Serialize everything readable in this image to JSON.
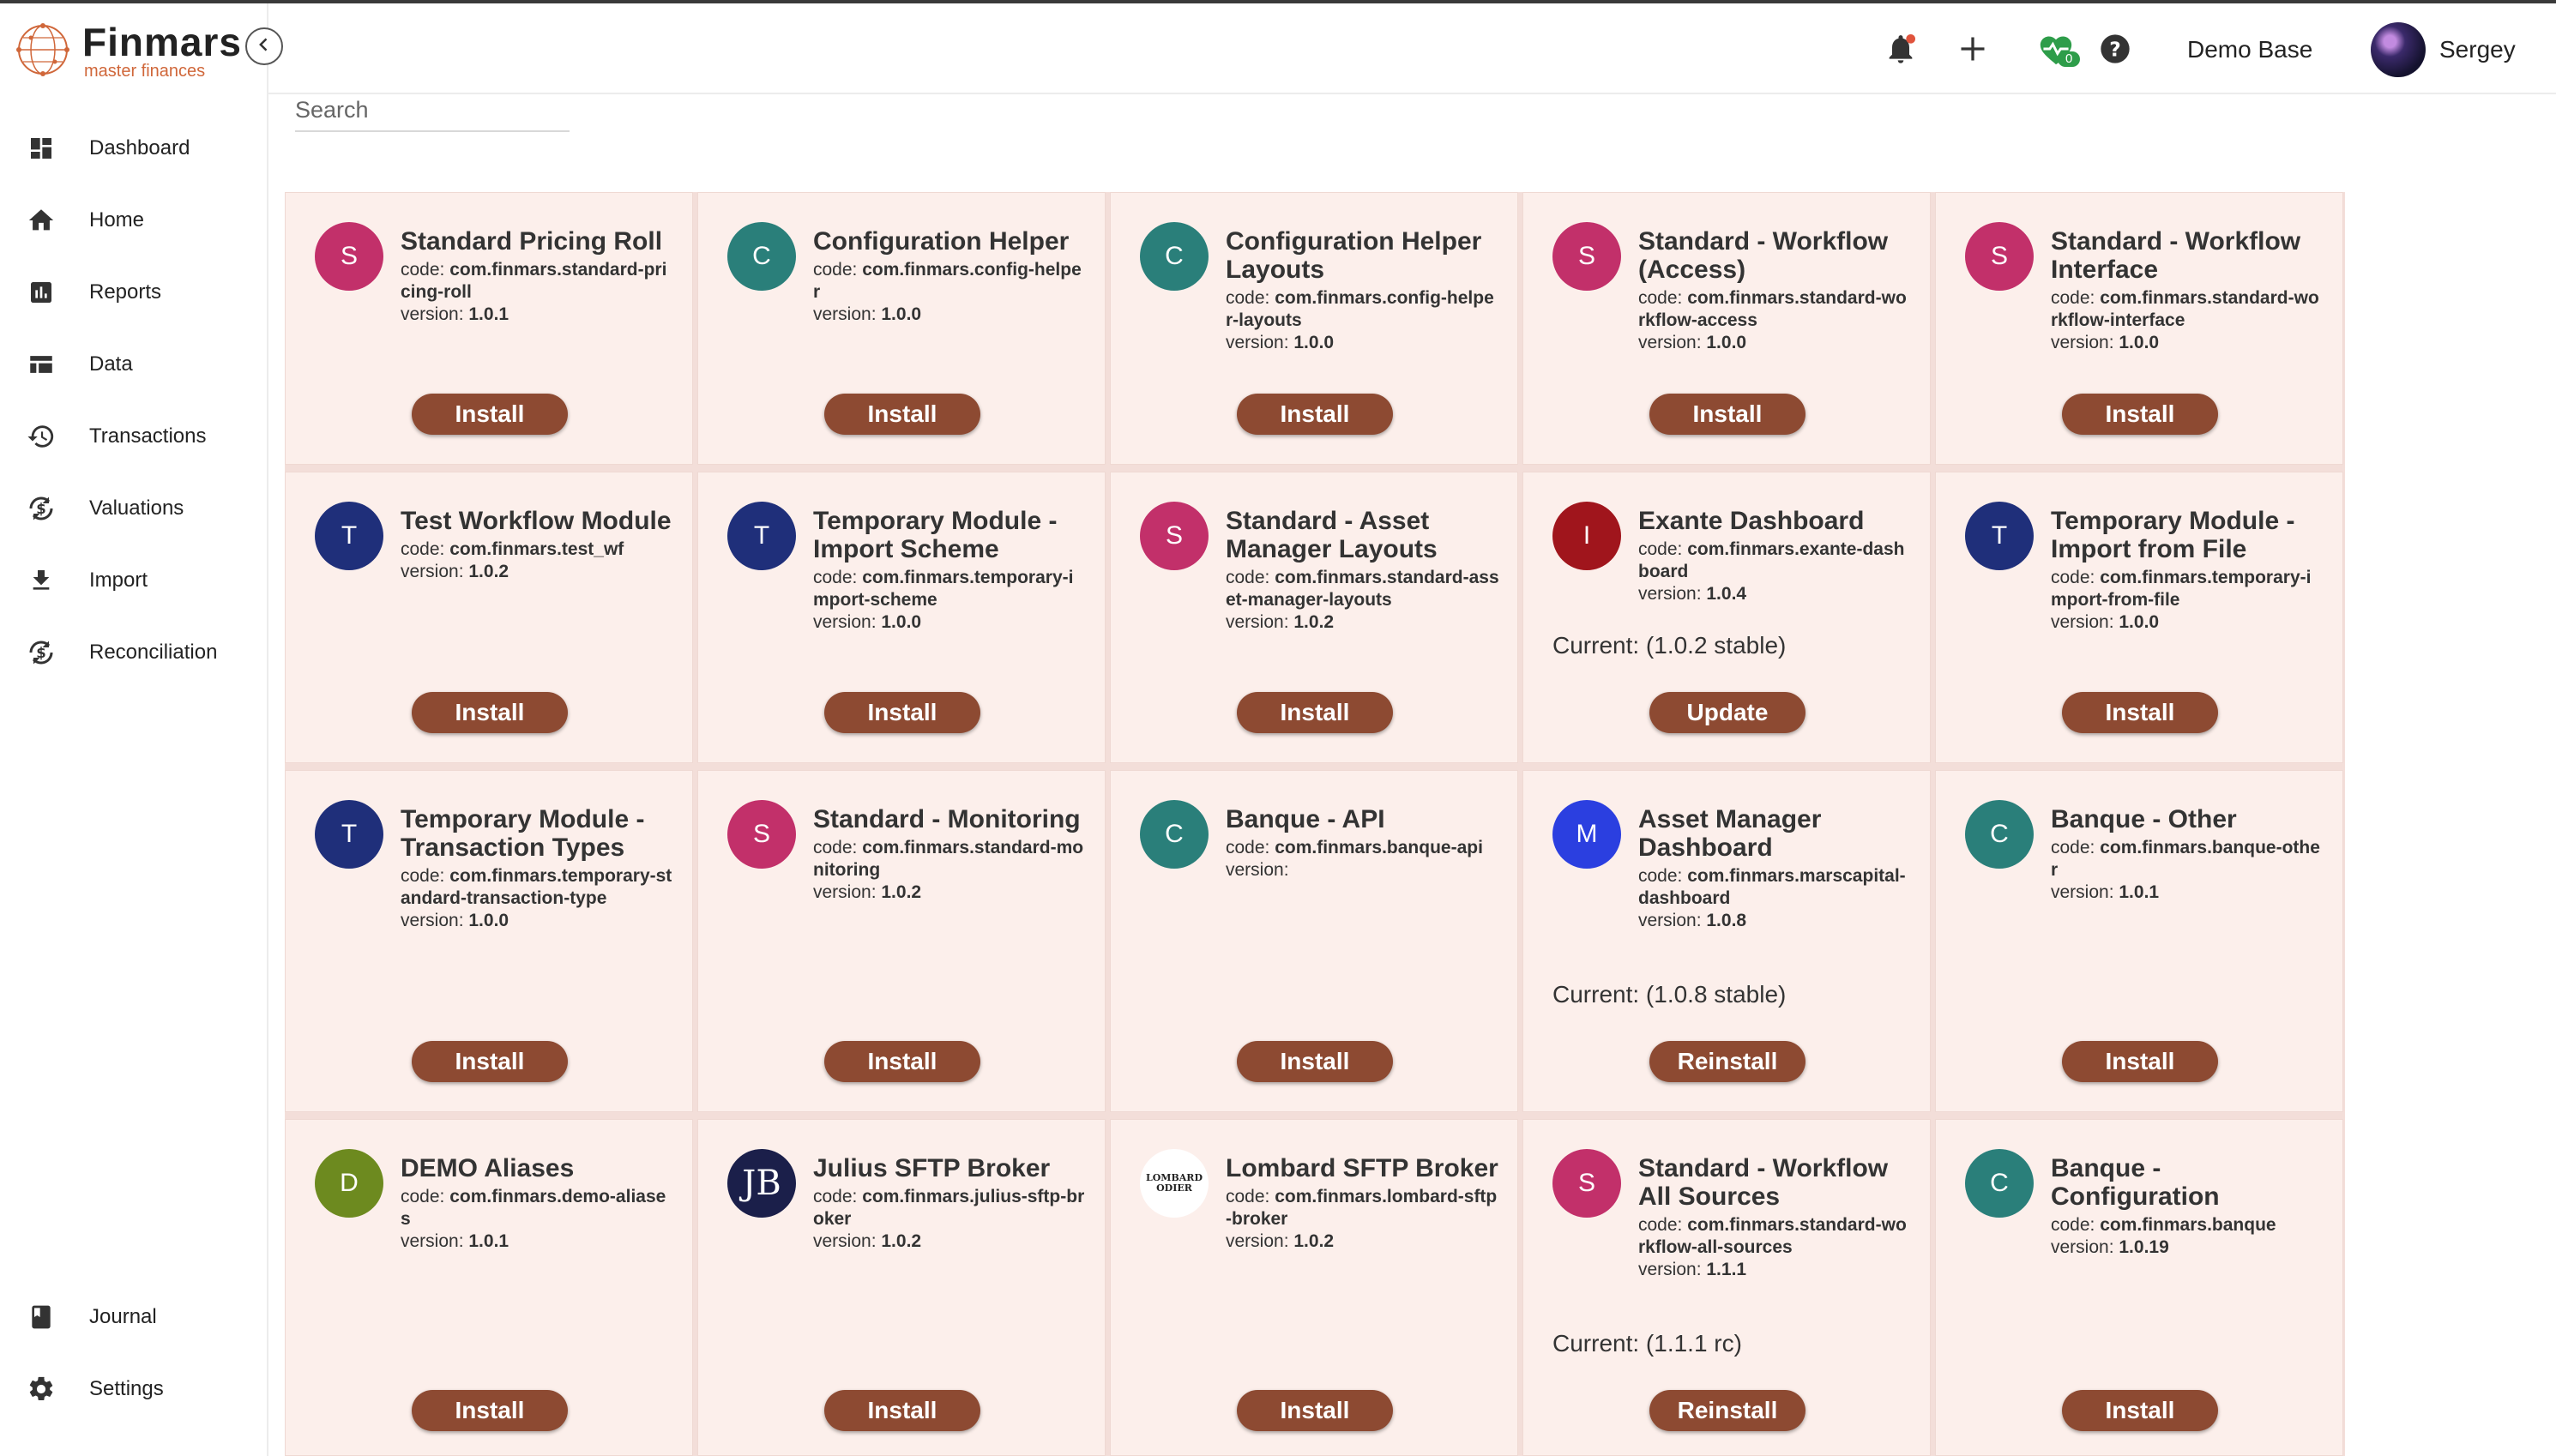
{
  "app": {
    "name": "Finmars",
    "tagline": "master finances"
  },
  "sidebar": {
    "items": [
      {
        "label": "Dashboard",
        "icon": "dashboard-icon"
      },
      {
        "label": "Home",
        "icon": "home-icon"
      },
      {
        "label": "Reports",
        "icon": "reports-icon"
      },
      {
        "label": "Data",
        "icon": "data-icon"
      },
      {
        "label": "Transactions",
        "icon": "history-icon"
      },
      {
        "label": "Valuations",
        "icon": "currency-sync-icon"
      },
      {
        "label": "Import",
        "icon": "download-icon"
      },
      {
        "label": "Reconciliation",
        "icon": "currency-sync-icon"
      }
    ],
    "bottom_items": [
      {
        "label": "Journal",
        "icon": "book-icon"
      },
      {
        "label": "Settings",
        "icon": "gear-icon"
      }
    ]
  },
  "header": {
    "health_count": "0",
    "base_name": "Demo Base",
    "user_name": "Sergey"
  },
  "search": {
    "placeholder": "Search"
  },
  "labels": {
    "code": "code:",
    "version": "version:"
  },
  "modules": [
    {
      "initial": "S",
      "color": "#c2306a",
      "title": "Standard Pricing Roll",
      "code": "com.finmars.standard-pricing-roll",
      "version": "1.0.1",
      "action": "Install"
    },
    {
      "initial": "C",
      "color": "#2a7f7a",
      "title": "Configuration Helper",
      "code": "com.finmars.config-helper",
      "version": "1.0.0",
      "action": "Install"
    },
    {
      "initial": "C",
      "color": "#2a7f7a",
      "title": "Configuration Helper Layouts",
      "code": "com.finmars.config-helper-layouts",
      "version": "1.0.0",
      "action": "Install"
    },
    {
      "initial": "S",
      "color": "#c2306a",
      "title": "Standard - Workflow (Access)",
      "code": "com.finmars.standard-workflow-access",
      "version": "1.0.0",
      "action": "Install"
    },
    {
      "initial": "S",
      "color": "#c2306a",
      "title": "Standard - Workflow Interface",
      "code": "com.finmars.standard-workflow-interface",
      "version": "1.0.0",
      "action": "Install"
    },
    {
      "initial": "T",
      "color": "#1f2f7a",
      "title": "Test Workflow Module",
      "code": "com.finmars.test_wf",
      "version": "1.0.2",
      "action": "Install"
    },
    {
      "initial": "T",
      "color": "#1f2f7a",
      "title": "Temporary Module - Import Scheme",
      "code": "com.finmars.temporary-import-scheme",
      "version": "1.0.0",
      "action": "Install"
    },
    {
      "initial": "S",
      "color": "#c2306a",
      "title": "Standard - Asset Manager Layouts",
      "code": "com.finmars.standard-asset-manager-layouts",
      "version": "1.0.2",
      "action": "Install"
    },
    {
      "initial": "I",
      "color": "#a0151c",
      "title": "Exante Dashboard",
      "code": "com.finmars.exante-dashboard",
      "version": "1.0.4",
      "current": "Current: (1.0.2 stable)",
      "action": "Update"
    },
    {
      "initial": "T",
      "color": "#1f2f7a",
      "title": "Temporary Module - Import from File",
      "code": "com.finmars.temporary-import-from-file",
      "version": "1.0.0",
      "action": "Install"
    },
    {
      "initial": "T",
      "color": "#1f2f7a",
      "title": "Temporary Module - Transaction Types",
      "code": "com.finmars.temporary-standard-transaction-type",
      "version": "1.0.0",
      "action": "Install"
    },
    {
      "initial": "S",
      "color": "#c2306a",
      "title": "Standard - Monitoring",
      "code": "com.finmars.standard-monitoring",
      "version": "1.0.2",
      "action": "Install"
    },
    {
      "initial": "C",
      "color": "#2a7f7a",
      "title": "Banque - API",
      "code": "com.finmars.banque-api",
      "version": "",
      "action": "Install"
    },
    {
      "initial": "M",
      "color": "#2b3fe0",
      "title": "Asset Manager Dashboard",
      "code": "com.finmars.marscapital-dashboard",
      "version": "1.0.8",
      "current": "Current: (1.0.8 stable)",
      "action": "Reinstall"
    },
    {
      "initial": "C",
      "color": "#2a7f7a",
      "title": "Banque - Other",
      "code": "com.finmars.banque-other",
      "version": "1.0.1",
      "action": "Install"
    },
    {
      "initial": "D",
      "color": "#6d8a1f",
      "title": "DEMO Aliases",
      "code": "com.finmars.demo-aliases",
      "version": "1.0.1",
      "action": "Install"
    },
    {
      "initial": "JB",
      "color": "#1b1f4a",
      "title": "Julius SFTP Broker",
      "code": "com.finmars.julius-sftp-broker",
      "version": "1.0.2",
      "action": "Install",
      "logo": "julius"
    },
    {
      "initial": "LOMBARD ODIER",
      "color": "#ffffff",
      "title": "Lombard SFTP Broker",
      "code": "com.finmars.lombard-sftp-broker",
      "version": "1.0.2",
      "action": "Install",
      "logo": "lombard"
    },
    {
      "initial": "S",
      "color": "#c2306a",
      "title": "Standard - Workflow All Sources",
      "code": "com.finmars.standard-workflow-all-sources",
      "version": "1.1.1",
      "current": "Current: (1.1.1 rc)",
      "action": "Reinstall"
    },
    {
      "initial": "C",
      "color": "#2a7f7a",
      "title": "Banque - Configuration",
      "code": "com.finmars.banque",
      "version": "1.0.19",
      "action": "Install"
    }
  ]
}
